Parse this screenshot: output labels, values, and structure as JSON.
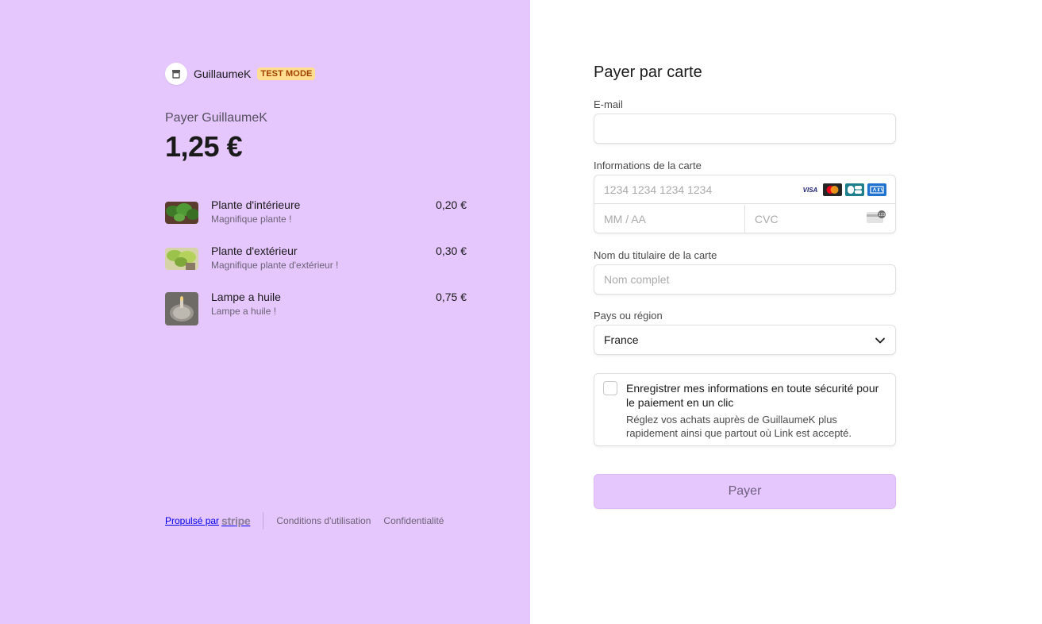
{
  "merchant": {
    "name": "GuillaumeK",
    "badge": "TEST MODE"
  },
  "summary": {
    "pay_to": "Payer GuillaumeK",
    "amount": "1,25 €"
  },
  "items": [
    {
      "name": "Plante d'intérieure",
      "description": "Magnifique plante !",
      "price": "0,20 €"
    },
    {
      "name": "Plante d'extérieur",
      "description": "Magnifique plante d'extérieur !",
      "price": "0,30 €"
    },
    {
      "name": "Lampe a huile",
      "description": "Lampe a huile !",
      "price": "0,75 €"
    }
  ],
  "footer": {
    "powered_by": "Propulsé par",
    "stripe": "stripe",
    "terms": "Conditions d'utilisation",
    "privacy": "Confidentialité"
  },
  "form": {
    "title": "Payer par carte",
    "email_label": "E-mail",
    "email_value": "",
    "card_label": "Informations de la carte",
    "card_number_placeholder": "1234 1234 1234 1234",
    "card_expiry_placeholder": "MM / AA",
    "card_cvc_placeholder": "CVC",
    "card_brands": [
      "visa-icon",
      "mastercard-icon",
      "cb-icon",
      "amex-icon"
    ],
    "name_label": "Nom du titulaire de la carte",
    "name_placeholder": "Nom complet",
    "country_label": "Pays ou région",
    "country_value": "France",
    "save_title": "Enregistrer mes informations en toute sécurité pour le paiement en un clic",
    "save_description": "Réglez vos achats auprès de GuillaumeK plus rapidement ainsi que partout où Link est accepté.",
    "save_checked": false,
    "pay_button": "Payer"
  },
  "colors": {
    "accent": "#e5c6fd",
    "badge_bg": "#ffde92",
    "badge_text": "#a04000"
  }
}
